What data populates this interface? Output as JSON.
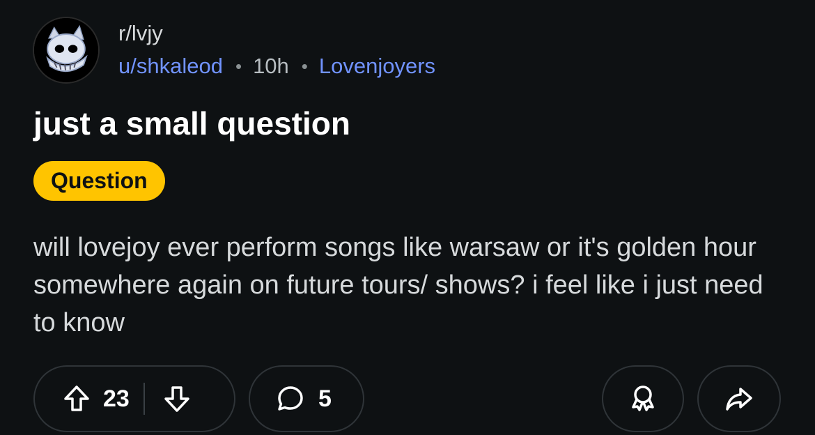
{
  "post": {
    "subreddit": "r/lvjy",
    "author": "u/shkaleod",
    "separator": "•",
    "time": "10h",
    "user_flair": "Lovenjoyers",
    "title": "just a small question",
    "post_flair": "Question",
    "body": "will lovejoy ever perform songs like warsaw or it's golden hour somewhere again on future tours/ shows? i feel like i just need to know"
  },
  "actions": {
    "upvote_icon": "arrow-up-icon",
    "vote_count": "23",
    "downvote_icon": "arrow-down-icon",
    "comment_icon": "speech-bubble-icon",
    "comment_count": "5",
    "award_icon": "award-ribbon-icon",
    "share_icon": "share-arrow-icon"
  },
  "colors": {
    "background": "#0e1113",
    "link_blue": "#7193ff",
    "flair_yellow": "#ffc400",
    "pill_border": "#2f3438"
  }
}
